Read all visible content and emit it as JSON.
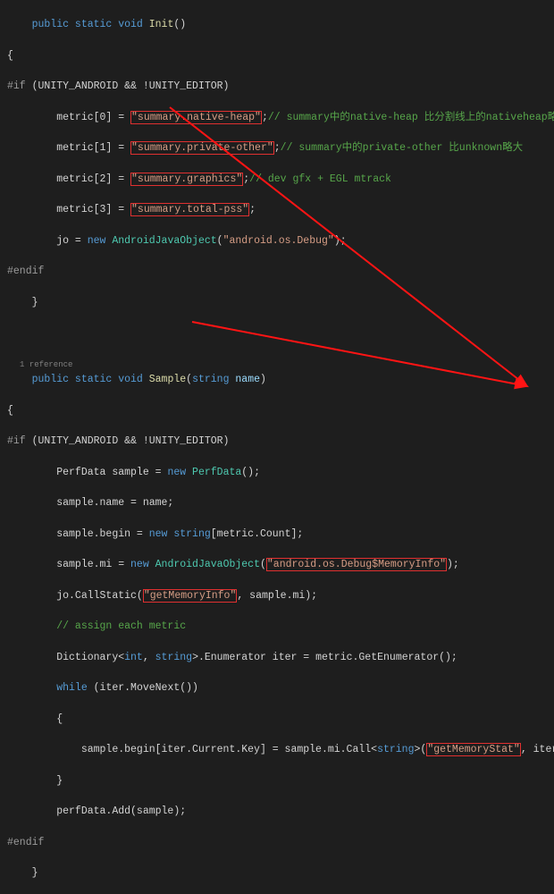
{
  "lines": {
    "l1_kw1": "public static void",
    "l1_fn": " Init",
    "l1_p": "()",
    "l2": "{",
    "l3_pp": "#if",
    "l3_cond": " (UNITY_ANDROID && !UNITY_EDITOR)",
    "l4_left": "        metric[0] = ",
    "l4_str": "\"summary.native-heap\"",
    "l4_semi": ";",
    "l4_cmt": "// summary中的native-heap 比分割线上的nativeheap略小",
    "l5_left": "        metric[1] = ",
    "l5_str": "\"summary.private-other\"",
    "l5_semi": ";",
    "l5_cmt": "// summary中的private-other 比unknown略大",
    "l6_left": "        metric[2] = ",
    "l6_str": "\"summary.graphics\"",
    "l6_semi": ";",
    "l6_cmt": "// dev gfx + EGL mtrack",
    "l7_left": "        metric[3] = ",
    "l7_str": "\"summary.total-pss\"",
    "l7_semi": ";",
    "l8a": "        jo = ",
    "l8_kw": "new",
    "l8_type": " AndroidJavaObject",
    "l8_p1": "(",
    "l8_str": "\"android.os.Debug\"",
    "l8_p2": ");",
    "l9_pp": "#endif",
    "l10": "    }",
    "refs": "1 reference",
    "l12_kw": "public static void",
    "l12_fn": " Sample",
    "l12_p1": "(",
    "l12_kw2": "string",
    "l12_arg": " name",
    "l12_p2": ")",
    "l13": "{",
    "l14_pp": "#if",
    "l14_cond": " (UNITY_ANDROID && !UNITY_EDITOR)",
    "l15a": "        PerfData sample = ",
    "l15_kw": "new",
    "l15_type": " PerfData",
    "l15b": "();",
    "l16": "        sample.name = name;",
    "l17a": "        sample.begin = ",
    "l17_kw": "new",
    "l17_kw2": " string",
    "l17b": "[metric.Count];",
    "l18a": "        sample.mi = ",
    "l18_kw": "new",
    "l18_type": " AndroidJavaObject",
    "l18_p1": "(",
    "l18_str": "\"android.os.Debug$MemoryInfo\"",
    "l18_p2": ");",
    "l19a": "        jo.CallStatic(",
    "l19_str": "\"getMemoryInfo\"",
    "l19b": ", sample.mi);",
    "l20_cmt": "        // assign each metric",
    "l21a": "        Dictionary<",
    "l21_kw": "int",
    "l21b": ", ",
    "l21_kw2": "string",
    "l21c": ">.Enumerator iter = metric.GetEnumerator();",
    "l22a": "        ",
    "l22_kw": "while",
    "l22b": " (iter.MoveNext())",
    "l23": "        {",
    "l24a": "            sample.begin[iter.Current.Key] = sample.mi.Call<",
    "l24_kw": "string",
    "l24b": ">(",
    "l24_str": "\"getMemoryStat\"",
    "l24c": ", iter.Current.Value);",
    "l25": "        }",
    "l26": "        perfData.Add(sample);",
    "l27_pp": "#endif",
    "l28": "    }"
  },
  "annotations": {
    "arrow_color": "#ff1414"
  }
}
